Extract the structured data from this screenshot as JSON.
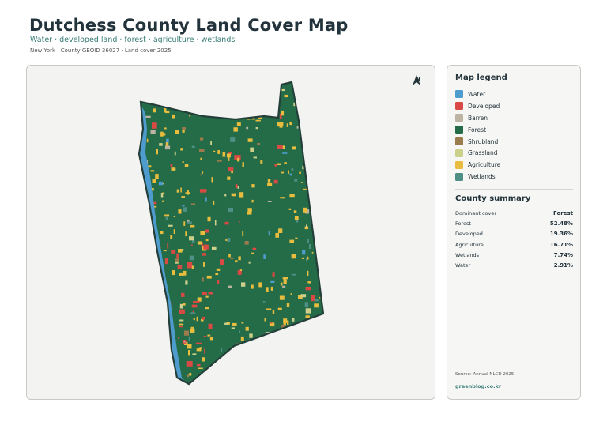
{
  "header": {
    "title": "Dutchess County Land Cover Map",
    "subtitle": "Water · developed land · forest · agriculture · wetlands",
    "meta": "New York · County GEOID 36027 · Land cover 2025"
  },
  "map": {
    "north_label": "N",
    "icons": {
      "north": "north-arrow-icon"
    },
    "outline_color": "#243f3a",
    "land_colors": {
      "water": "#4e9ccd",
      "developed": "#d94a44",
      "barren": "#bdb3a2",
      "forest": "#246b48",
      "shrubland": "#9b7b4e",
      "grassland": "#cdd08a",
      "agriculture": "#e8bd3f",
      "wetlands": "#4e8f86"
    }
  },
  "legend": {
    "heading": "Map legend",
    "items": [
      {
        "label": "Water",
        "color": "#4e9ccd"
      },
      {
        "label": "Developed",
        "color": "#d94a44"
      },
      {
        "label": "Barren",
        "color": "#bdb3a2"
      },
      {
        "label": "Forest",
        "color": "#246b48"
      },
      {
        "label": "Shrubland",
        "color": "#9b7b4e"
      },
      {
        "label": "Grassland",
        "color": "#cdd08a"
      },
      {
        "label": "Agriculture",
        "color": "#e8bd3f"
      },
      {
        "label": "Wetlands",
        "color": "#4e8f86"
      }
    ]
  },
  "summary": {
    "heading": "County summary",
    "rows": [
      {
        "label": "Dominant cover",
        "value": "Forest"
      },
      {
        "label": "Forest",
        "value": "52.48%"
      },
      {
        "label": "Developed",
        "value": "19.36%"
      },
      {
        "label": "Agriculture",
        "value": "16.71%"
      },
      {
        "label": "Wetlands",
        "value": "7.74%"
      },
      {
        "label": "Water",
        "value": "2.91%"
      }
    ]
  },
  "footer": {
    "source": "Source: Annual NLCD 2025",
    "site": "greenblog.co.kr"
  }
}
